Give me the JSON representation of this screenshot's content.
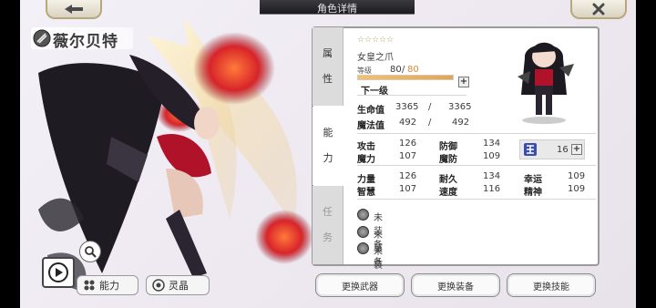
{
  "window": {
    "title": "角色详情"
  },
  "character": {
    "name": "薇尔贝特"
  },
  "tabs": [
    {
      "label_top": "属",
      "label_bottom": "性"
    },
    {
      "label_top": "能",
      "label_bottom": "力"
    },
    {
      "label_top": "任",
      "label_bottom": "务"
    }
  ],
  "stars": "☆☆☆☆☆",
  "title_name": "女皇之爪",
  "level": {
    "label": "等级",
    "current": "80",
    "slash": "/",
    "max": "80",
    "progress": 1.0,
    "next_label": "下一级"
  },
  "hp": {
    "label": "生命值",
    "current": "3365",
    "slash": "/",
    "max": "3365"
  },
  "mp": {
    "label": "魔法值",
    "current": "492",
    "slash": "/",
    "max": "492"
  },
  "stats": [
    {
      "label": "攻击",
      "value": "126"
    },
    {
      "label": "防御",
      "value": "134"
    },
    {
      "label": "魔力",
      "value": "107"
    },
    {
      "label": "魔防",
      "value": "109"
    },
    {
      "label": "力量",
      "value": "126"
    },
    {
      "label": "耐久",
      "value": "134"
    },
    {
      "label": "幸运",
      "value": "109"
    },
    {
      "label": "智慧",
      "value": "107"
    },
    {
      "label": "速度",
      "value": "116"
    },
    {
      "label": "精神",
      "value": "109"
    }
  ],
  "skill_card": {
    "value": "16"
  },
  "equipment": [
    {
      "label": "未装备",
      "icon": "sword-slot-icon"
    },
    {
      "label": "未装备",
      "icon": "armor-slot-icon"
    },
    {
      "label": "未装备",
      "icon": "accessory-slot-icon"
    }
  ],
  "buttons": {
    "change_weapon": "更换武器",
    "change_equipment": "更换装备",
    "change_skill": "更换技能",
    "ability": "能力",
    "spirit_crystal": "灵晶"
  },
  "colors": {
    "accent_gold": "#b8a77a",
    "exp_fill": "#e8a44a"
  }
}
